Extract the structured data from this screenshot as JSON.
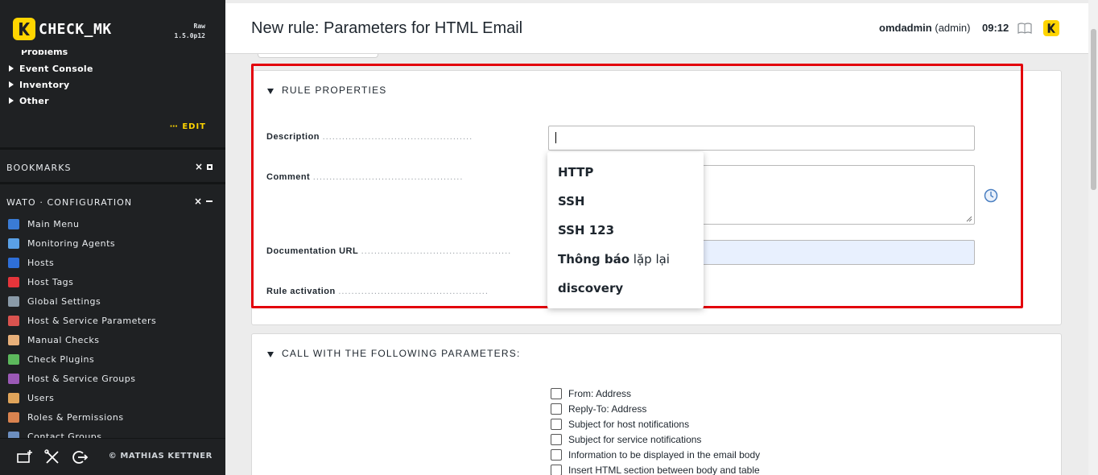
{
  "sidebar": {
    "logo_text": "CHECK_MK",
    "edition": "Raw",
    "version": "1.5.0p12",
    "partial_item": "Problems",
    "tree_items": [
      "Event Console",
      "Inventory",
      "Other"
    ],
    "edit_label": "⋯ EDIT",
    "bookmarks_title": "BOOKMARKS",
    "wato_title": "WATO · CONFIGURATION",
    "menu_items": [
      {
        "label": "Main Menu",
        "color": "#3a7bd5"
      },
      {
        "label": "Monitoring Agents",
        "color": "#5aa0e6"
      },
      {
        "label": "Hosts",
        "color": "#2e6fd8"
      },
      {
        "label": "Host Tags",
        "color": "#e5353b"
      },
      {
        "label": "Global Settings",
        "color": "#8a9aa8"
      },
      {
        "label": "Host & Service Parameters",
        "color": "#d9534f"
      },
      {
        "label": "Manual Checks",
        "color": "#e8b07a"
      },
      {
        "label": "Check Plugins",
        "color": "#5cb85c"
      },
      {
        "label": "Host & Service Groups",
        "color": "#9b59b6"
      },
      {
        "label": "Users",
        "color": "#e0a45a"
      },
      {
        "label": "Roles & Permissions",
        "color": "#d9834f"
      },
      {
        "label": "Contact Groups",
        "color": "#6c8ebf"
      }
    ],
    "footer_text": "© MATHIAS KETTNER"
  },
  "header": {
    "title": "New rule: Parameters for HTML Email",
    "user": "omdadmin",
    "role": "(admin)",
    "time": "09:12"
  },
  "rule_properties": {
    "title": "RULE PROPERTIES",
    "description_label": "Description",
    "comment_label": "Comment",
    "doc_url_label": "Documentation URL",
    "activation_label": "Rule activation",
    "dots": "..............................................",
    "description_value": "",
    "comment_value": "",
    "doc_url_value": ""
  },
  "autocomplete": {
    "items": [
      {
        "bold": "HTTP",
        "normal": ""
      },
      {
        "bold": "SSH",
        "normal": ""
      },
      {
        "bold": "SSH 123",
        "normal": ""
      },
      {
        "bold": "Thông báo",
        "normal": " lặp lại"
      },
      {
        "bold": "discovery",
        "normal": ""
      }
    ]
  },
  "call_params": {
    "title": "CALL WITH THE FOLLOWING PARAMETERS:",
    "options": [
      "From: Address",
      "Reply-To: Address",
      "Subject for host notifications",
      "Subject for service notifications",
      "Information to be displayed in the email body",
      "Insert HTML section between body and table"
    ]
  },
  "colors": {
    "accent": "#ffd500",
    "highlight": "#e3000b",
    "sidebar_bg": "#1f2123"
  }
}
